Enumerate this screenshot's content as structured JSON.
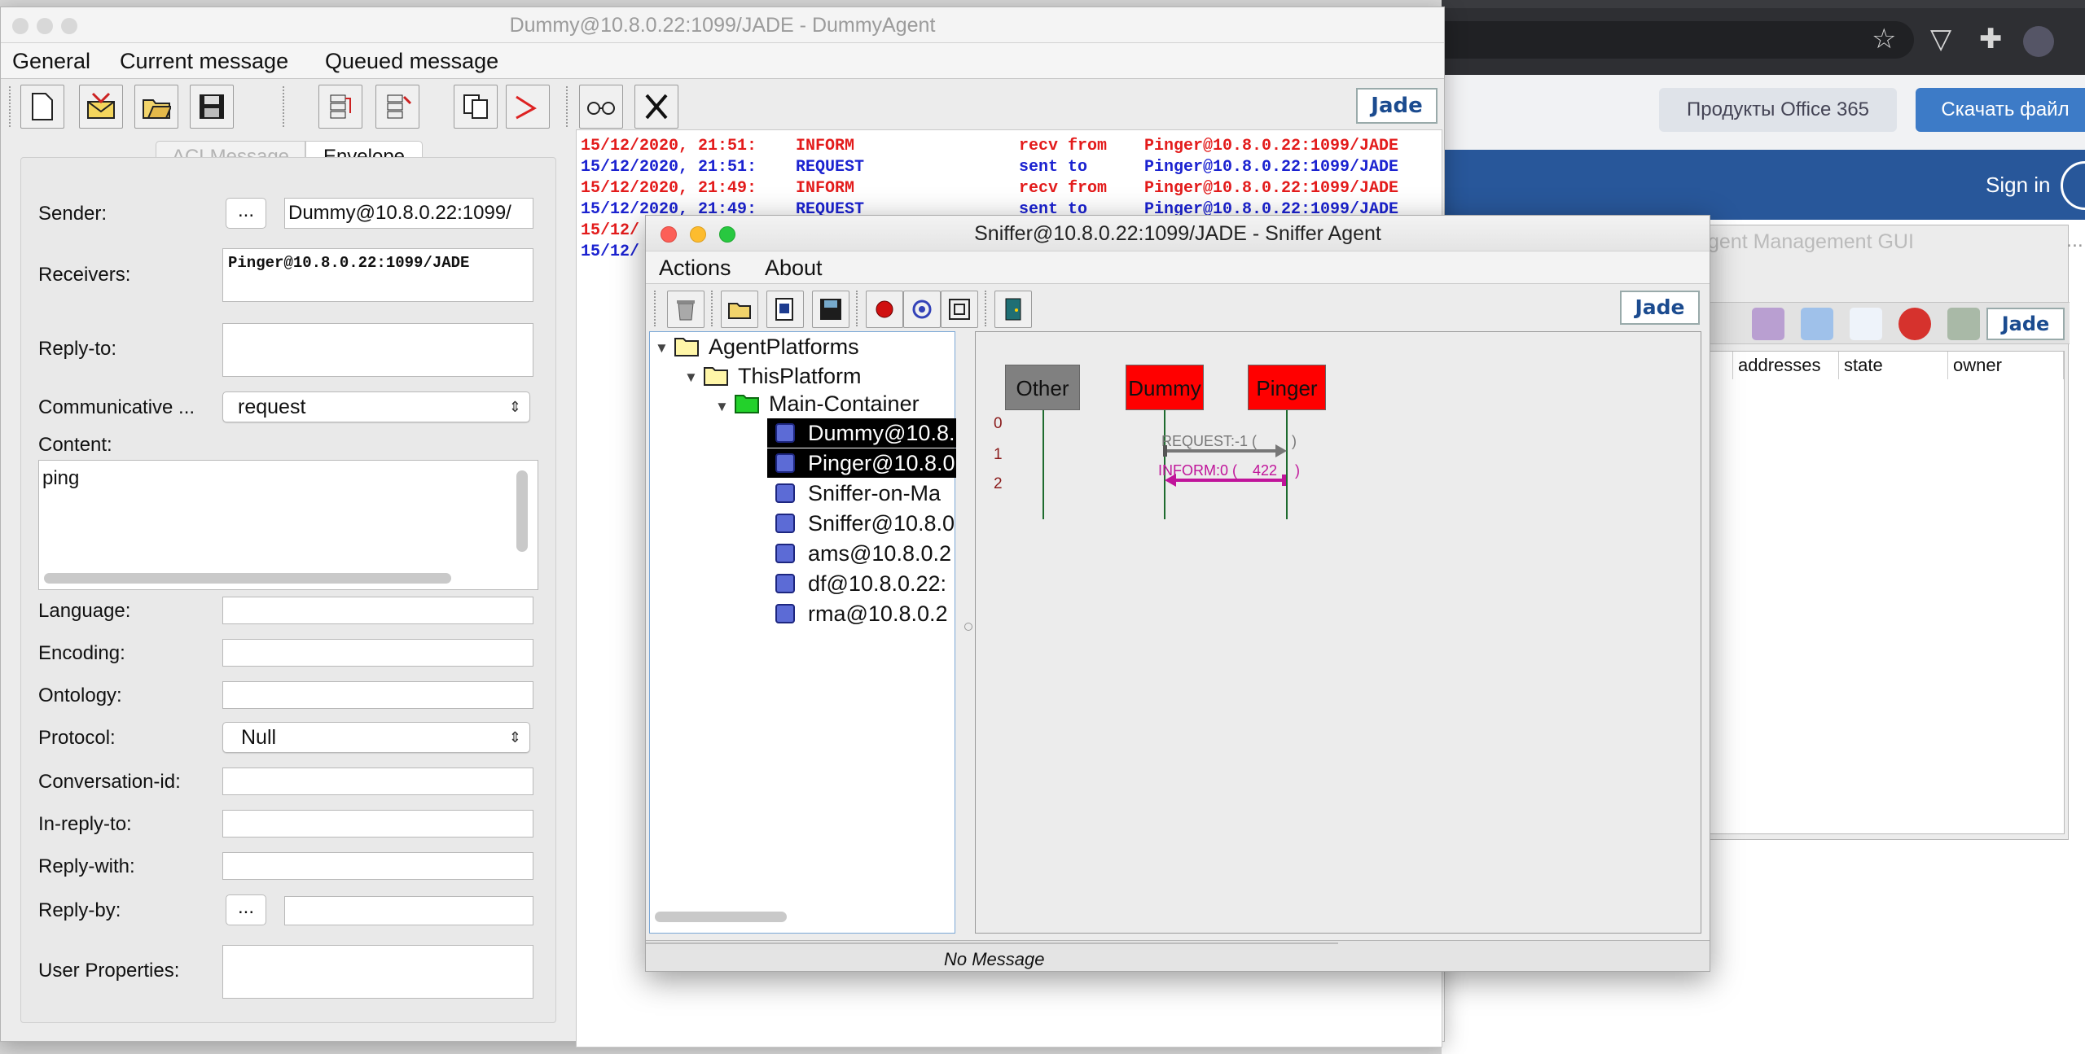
{
  "browser": {
    "office_button": "Продукты Office 365",
    "download_button": "Скачать файл",
    "sign_in": "Sign in",
    "star_icon": "star-icon",
    "extension_icon": "puzzle-icon"
  },
  "rma": {
    "title": "gent Management GUI",
    "more": "...",
    "columns": [
      "addresses",
      "state",
      "owner"
    ]
  },
  "dummy": {
    "window_title": "Dummy@10.8.0.22:1099/JADE - DummyAgent",
    "menu": [
      "General",
      "Current message",
      "Queued message"
    ],
    "tabs": [
      "ACLMessage",
      "Envelope"
    ],
    "sender_label": "Sender:",
    "sender_btn": "...",
    "sender_value": "Dummy@10.8.0.22:1099/",
    "receivers_label": "Receivers:",
    "receivers_value": "Pinger@10.8.0.22:1099/JADE",
    "replyto_label": "Reply-to:",
    "performative_label": "Communicative ...",
    "performative_value": "request",
    "content_label": "Content:",
    "content_value": "ping",
    "language_label": "Language:",
    "encoding_label": "Encoding:",
    "ontology_label": "Ontology:",
    "protocol_label": "Protocol:",
    "protocol_value": "Null",
    "conversation_label": "Conversation-id:",
    "inreplyto_label": "In-reply-to:",
    "replywith_label": "Reply-with:",
    "replyby_label": "Reply-by:",
    "replyby_btn": "...",
    "userprops_label": "User Properties:",
    "jade_logo": "Jade",
    "log": [
      {
        "date": "15/12/2020, 21:51:",
        "perf": "INFORM",
        "dir": "recv from",
        "agent": "Pinger@10.8.0.22:1099/JADE",
        "color": "#e31b1b"
      },
      {
        "date": "15/12/2020, 21:51:",
        "perf": "REQUEST",
        "dir": "sent to",
        "agent": "Pinger@10.8.0.22:1099/JADE",
        "color": "#1b22d0"
      },
      {
        "date": "15/12/2020, 21:49:",
        "perf": "INFORM",
        "dir": "recv from",
        "agent": "Pinger@10.8.0.22:1099/JADE",
        "color": "#e31b1b"
      },
      {
        "date": "15/12/2020, 21:49:",
        "perf": "REQUEST",
        "dir": "sent to",
        "agent": "Pinger@10.8.0.22:1099/JADE",
        "color": "#1b22d0"
      },
      {
        "date": "15/12/",
        "color": "#e31b1b"
      },
      {
        "date": "15/12/",
        "color": "#1b22d0"
      }
    ]
  },
  "sniffer": {
    "window_title": "Sniffer@10.8.0.22:1099/JADE - Sniffer Agent",
    "menu": [
      "Actions",
      "About"
    ],
    "tree": {
      "root": "AgentPlatforms",
      "platform": "ThisPlatform",
      "container": "Main-Container",
      "agents": [
        "Dummy@10.8.",
        "Pinger@10.8.0",
        "Sniffer-on-Ma",
        "Sniffer@10.8.0",
        "ams@10.8.0.2",
        "df@10.8.0.22:",
        "rma@10.8.0.2"
      ]
    },
    "agents_row": [
      "Other",
      "Dummy",
      "Pinger"
    ],
    "row_indices": [
      "0",
      "1",
      "2"
    ],
    "messages": [
      {
        "label": "REQUEST:-1 (",
        "extra": ")",
        "color": "#777777"
      },
      {
        "label": "INFORM:0 (",
        "extra": "422",
        "close": ")",
        "color": "#c0149a"
      }
    ],
    "status": "No Message",
    "jade_logo": "Jade"
  },
  "colors": {
    "agent_red": "#ff0000",
    "agent_gray": "#808080",
    "log_red": "#e31b1b",
    "log_blue": "#1b22d0",
    "inform_magenta": "#c0149a"
  }
}
